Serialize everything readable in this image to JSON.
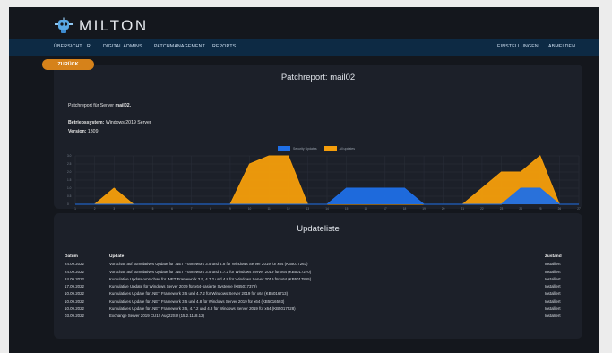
{
  "brand": {
    "name": "MILTON"
  },
  "nav": {
    "items": [
      "ÜBERSICHT",
      "RI",
      "DIGITAL ADMINS",
      "PATCHMANAGEMENT",
      "REPORTS"
    ],
    "right": [
      "EINSTELLUNGEN",
      "ABMELDEN"
    ]
  },
  "back_label": "ZURÜCK",
  "report": {
    "title": "Patchreport: mail02",
    "server_prefix": "Patchreport für Server ",
    "server_name": "mail02.",
    "os_label": "Betriebssystem:",
    "os_value": " Windows 2019 Server",
    "version_label": "Version:",
    "version_value": " 1809"
  },
  "chart_data": {
    "type": "area",
    "x": [
      1,
      2,
      3,
      4,
      5,
      6,
      7,
      8,
      9,
      10,
      11,
      12,
      13,
      14,
      15,
      16,
      17,
      18,
      19,
      20,
      21,
      22,
      23,
      24,
      25,
      26,
      27
    ],
    "ylim": [
      0,
      3
    ],
    "y_ticks": [
      "0",
      "0.5",
      "1.0",
      "1.5",
      "2.0",
      "2.5",
      "3.0"
    ],
    "series": [
      {
        "name": "Security Updates",
        "color": "#1f6fe6",
        "values": [
          0,
          0,
          0,
          0,
          0,
          0,
          0,
          0,
          0,
          0,
          0,
          0,
          0,
          0,
          1,
          1,
          1,
          1,
          0,
          0,
          0,
          0,
          0,
          1,
          1,
          0,
          0
        ]
      },
      {
        "name": "All updates",
        "color": "#f59e0b",
        "values": [
          0,
          0,
          1,
          0,
          0,
          0,
          0,
          0,
          0,
          2.5,
          3,
          3,
          0,
          0,
          0,
          0,
          0,
          0,
          0,
          0,
          0,
          1,
          2,
          2,
          3,
          0,
          0
        ]
      }
    ]
  },
  "updates": {
    "title": "Updateliste",
    "headers": [
      "Datum",
      "Update",
      "Zustand"
    ],
    "rows": [
      [
        "24.09.2022",
        "Vorschau auf kumulatives Update für .NET Framework 3.5 und 4.8 für Windows Server 2019 für x64 (KB5017263)",
        "Installiert"
      ],
      [
        "24.09.2022",
        "Vorschau auf kumulatives Update für .NET Framework 3.5 und 4.7.2 für Windows Server 2019 für x64 (KB5017270)",
        "Installiert"
      ],
      [
        "24.09.2022",
        "Kumulative Update-Vorschau für .NET Framework 3.5, 4.7.2 und 4.8 für Windows Server 2019 für x64 (KB5017855)",
        "Installiert"
      ],
      [
        "17.09.2022",
        "Kumulative Update für Windows Server 2019 für x64-basierte Systeme (KB5017379)",
        "Installiert"
      ],
      [
        "10.09.2022",
        "Kumulatives Update für .NET Framework 3.5 und 4.7.2 für Windows Server 2019 für x64 (KB5016713)",
        "Installiert"
      ],
      [
        "10.09.2022",
        "Kumulatives Update für .NET Framework 3.5 und 4.8 für Windows Server 2019 für x64 (KB5016593)",
        "Installiert"
      ],
      [
        "10.09.2022",
        "Kumulatives Update für .NET Framework 3.5, 4.7.2 und 4.8 für Windows Server 2019 für x64 (KB5017528)",
        "Installiert"
      ],
      [
        "03.09.2022",
        "Exchange Server 2019 CU12 Aug22SU (15.2.1118.12)",
        "Installiert"
      ]
    ]
  }
}
